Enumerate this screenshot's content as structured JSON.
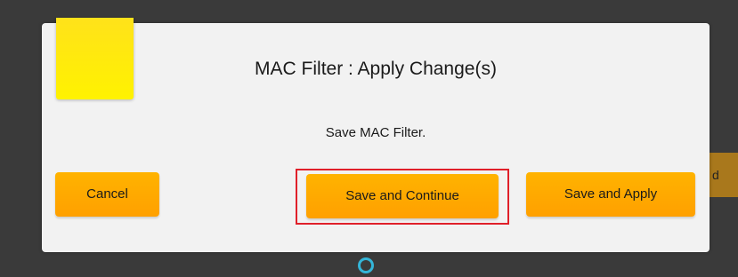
{
  "dialog": {
    "title": "MAC Filter : Apply Change(s)",
    "message": "Save MAC Filter.",
    "buttons": {
      "cancel": "Cancel",
      "save_continue": "Save and Continue",
      "save_apply": "Save and Apply"
    }
  },
  "background": {
    "partial_button_text": "d"
  },
  "colors": {
    "button": "#ffa800",
    "accent_tab": "#fff200",
    "highlight": "#e0202a",
    "dialog_bg": "#f2f2f2",
    "page_bg": "#3a3a3a"
  },
  "icons": {
    "bottom": "refresh-icon"
  }
}
